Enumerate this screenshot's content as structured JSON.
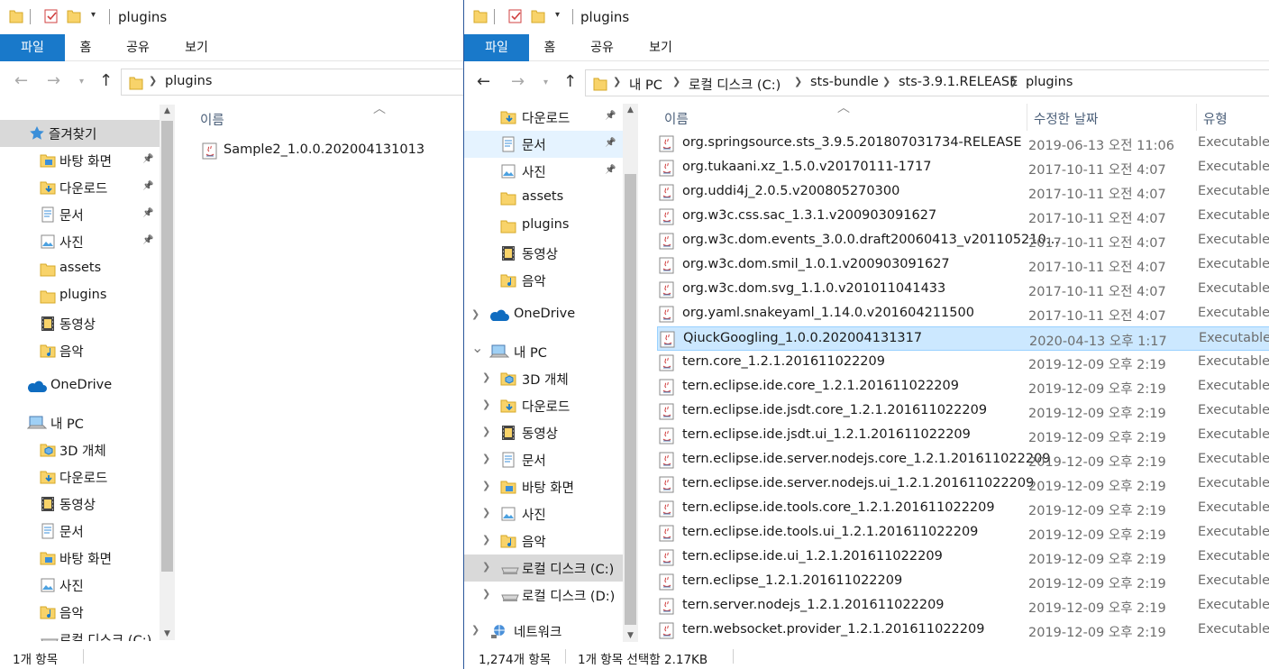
{
  "left_window": {
    "title": "plugins",
    "ribbon_tabs": [
      "파일",
      "홈",
      "공유",
      "보기"
    ],
    "address": {
      "crumbs": [
        "plugins"
      ]
    },
    "nav_items": [
      {
        "label": "즐겨찾기",
        "icon": "star-icon",
        "pinned": false
      },
      {
        "label": "바탕 화면",
        "icon": "desktop-folder-icon",
        "pinned": true
      },
      {
        "label": "다운로드",
        "icon": "download-folder-icon",
        "pinned": true
      },
      {
        "label": "문서",
        "icon": "documents-folder-icon",
        "pinned": true
      },
      {
        "label": "사진",
        "icon": "pictures-folder-icon",
        "pinned": true
      },
      {
        "label": "assets",
        "icon": "folder-icon",
        "pinned": false
      },
      {
        "label": "plugins",
        "icon": "folder-icon",
        "pinned": false
      },
      {
        "label": "동영상",
        "icon": "videos-folder-icon",
        "pinned": false
      },
      {
        "label": "음악",
        "icon": "music-folder-icon",
        "pinned": false
      },
      {
        "label": "OneDrive",
        "icon": "onedrive-icon",
        "pinned": false
      },
      {
        "label": "내 PC",
        "icon": "this-pc-icon",
        "pinned": false
      },
      {
        "label": "3D 개체",
        "icon": "3d-objects-folder-icon",
        "pinned": false
      },
      {
        "label": "다운로드",
        "icon": "download-folder-icon",
        "pinned": false
      },
      {
        "label": "동영상",
        "icon": "videos-folder-icon",
        "pinned": false
      },
      {
        "label": "문서",
        "icon": "documents-folder-icon",
        "pinned": false
      },
      {
        "label": "바탕 화면",
        "icon": "desktop-folder-icon",
        "pinned": false
      },
      {
        "label": "사진",
        "icon": "pictures-folder-icon",
        "pinned": false
      },
      {
        "label": "음악",
        "icon": "music-folder-icon",
        "pinned": false
      },
      {
        "label": "로컬 디스크 (C:)",
        "icon": "local-disk-icon",
        "pinned": false
      }
    ],
    "column_header": "이름",
    "files": [
      {
        "name": "Sample2_1.0.0.202004131013"
      }
    ],
    "status": {
      "count": "1개 항목"
    }
  },
  "right_window": {
    "title": "plugins",
    "ribbon_tabs": [
      "파일",
      "홈",
      "공유",
      "보기"
    ],
    "address": {
      "crumbs": [
        "내 PC",
        "로컬 디스크 (C:)",
        "sts-bundle",
        "sts-3.9.1.RELEASE",
        "plugins"
      ]
    },
    "nav_items": [
      {
        "label": "다운로드",
        "icon": "download-folder-icon",
        "pinned": true,
        "expander": false
      },
      {
        "label": "문서",
        "icon": "documents-folder-icon",
        "pinned": true,
        "expander": false
      },
      {
        "label": "사진",
        "icon": "pictures-folder-icon",
        "pinned": true,
        "expander": false
      },
      {
        "label": "assets",
        "icon": "folder-icon",
        "pinned": false,
        "expander": false
      },
      {
        "label": "plugins",
        "icon": "folder-icon",
        "pinned": false,
        "expander": false
      },
      {
        "label": "동영상",
        "icon": "videos-folder-icon",
        "pinned": false,
        "expander": false
      },
      {
        "label": "음악",
        "icon": "music-folder-icon",
        "pinned": false,
        "expander": false
      },
      {
        "label": "OneDrive",
        "icon": "onedrive-icon",
        "pinned": false,
        "expander": "collapsed"
      },
      {
        "label": "내 PC",
        "icon": "this-pc-icon",
        "pinned": false,
        "expander": "expanded"
      },
      {
        "label": "3D 개체",
        "icon": "3d-objects-folder-icon",
        "pinned": false,
        "expander": "collapsed"
      },
      {
        "label": "다운로드",
        "icon": "download-folder-icon",
        "pinned": false,
        "expander": "collapsed"
      },
      {
        "label": "동영상",
        "icon": "videos-folder-icon",
        "pinned": false,
        "expander": "collapsed"
      },
      {
        "label": "문서",
        "icon": "documents-folder-icon",
        "pinned": false,
        "expander": "collapsed"
      },
      {
        "label": "바탕 화면",
        "icon": "desktop-folder-icon",
        "pinned": false,
        "expander": "collapsed"
      },
      {
        "label": "사진",
        "icon": "pictures-folder-icon",
        "pinned": false,
        "expander": "collapsed"
      },
      {
        "label": "음악",
        "icon": "music-folder-icon",
        "pinned": false,
        "expander": "collapsed"
      },
      {
        "label": "로컬 디스크 (C:)",
        "icon": "local-disk-icon",
        "pinned": false,
        "expander": "collapsed"
      },
      {
        "label": "로컬 디스크 (D:)",
        "icon": "local-disk-icon",
        "pinned": false,
        "expander": "collapsed"
      },
      {
        "label": "네트워크",
        "icon": "network-icon",
        "pinned": false,
        "expander": "collapsed"
      }
    ],
    "columns": {
      "name": "이름",
      "date": "수정한 날짜",
      "type": "유형"
    },
    "files": [
      {
        "name": "org.springsource.sts_3.9.5.201807031734-RELEASE",
        "date": "2019-06-13 오전 11:06",
        "type": "Executable"
      },
      {
        "name": "org.tukaani.xz_1.5.0.v20170111-1717",
        "date": "2017-10-11 오전 4:07",
        "type": "Executable"
      },
      {
        "name": "org.uddi4j_2.0.5.v200805270300",
        "date": "2017-10-11 오전 4:07",
        "type": "Executable"
      },
      {
        "name": "org.w3c.css.sac_1.3.1.v200903091627",
        "date": "2017-10-11 오전 4:07",
        "type": "Executable"
      },
      {
        "name": "org.w3c.dom.events_3.0.0.draft20060413_v201105210…",
        "date": "2017-10-11 오전 4:07",
        "type": "Executable"
      },
      {
        "name": "org.w3c.dom.smil_1.0.1.v200903091627",
        "date": "2017-10-11 오전 4:07",
        "type": "Executable"
      },
      {
        "name": "org.w3c.dom.svg_1.1.0.v201011041433",
        "date": "2017-10-11 오전 4:07",
        "type": "Executable"
      },
      {
        "name": "org.yaml.snakeyaml_1.14.0.v201604211500",
        "date": "2017-10-11 오전 4:07",
        "type": "Executable"
      },
      {
        "name": "QiuckGoogling_1.0.0.202004131317",
        "date": "2020-04-13 오후 1:17",
        "type": "Executable",
        "selected": true
      },
      {
        "name": "tern.core_1.2.1.201611022209",
        "date": "2019-12-09 오후 2:19",
        "type": "Executable"
      },
      {
        "name": "tern.eclipse.ide.core_1.2.1.201611022209",
        "date": "2019-12-09 오후 2:19",
        "type": "Executable"
      },
      {
        "name": "tern.eclipse.ide.jsdt.core_1.2.1.201611022209",
        "date": "2019-12-09 오후 2:19",
        "type": "Executable"
      },
      {
        "name": "tern.eclipse.ide.jsdt.ui_1.2.1.201611022209",
        "date": "2019-12-09 오후 2:19",
        "type": "Executable"
      },
      {
        "name": "tern.eclipse.ide.server.nodejs.core_1.2.1.201611022209",
        "date": "2019-12-09 오후 2:19",
        "type": "Executable"
      },
      {
        "name": "tern.eclipse.ide.server.nodejs.ui_1.2.1.201611022209",
        "date": "2019-12-09 오후 2:19",
        "type": "Executable"
      },
      {
        "name": "tern.eclipse.ide.tools.core_1.2.1.201611022209",
        "date": "2019-12-09 오후 2:19",
        "type": "Executable"
      },
      {
        "name": "tern.eclipse.ide.tools.ui_1.2.1.201611022209",
        "date": "2019-12-09 오후 2:19",
        "type": "Executable"
      },
      {
        "name": "tern.eclipse.ide.ui_1.2.1.201611022209",
        "date": "2019-12-09 오후 2:19",
        "type": "Executable"
      },
      {
        "name": "tern.eclipse_1.2.1.201611022209",
        "date": "2019-12-09 오후 2:19",
        "type": "Executable"
      },
      {
        "name": "tern.server.nodejs_1.2.1.201611022209",
        "date": "2019-12-09 오후 2:19",
        "type": "Executable"
      },
      {
        "name": "tern.websocket.provider_1.2.1.201611022209",
        "date": "2019-12-09 오후 2:19",
        "type": "Executable"
      }
    ],
    "status": {
      "count": "1,274개 항목",
      "selection": "1개 항목 선택함 2.17KB"
    }
  },
  "colors": {
    "accent": "#1979ca",
    "selection": "#cce8ff",
    "selection_border": "#99d1ff",
    "folder": "#f8d36a"
  }
}
